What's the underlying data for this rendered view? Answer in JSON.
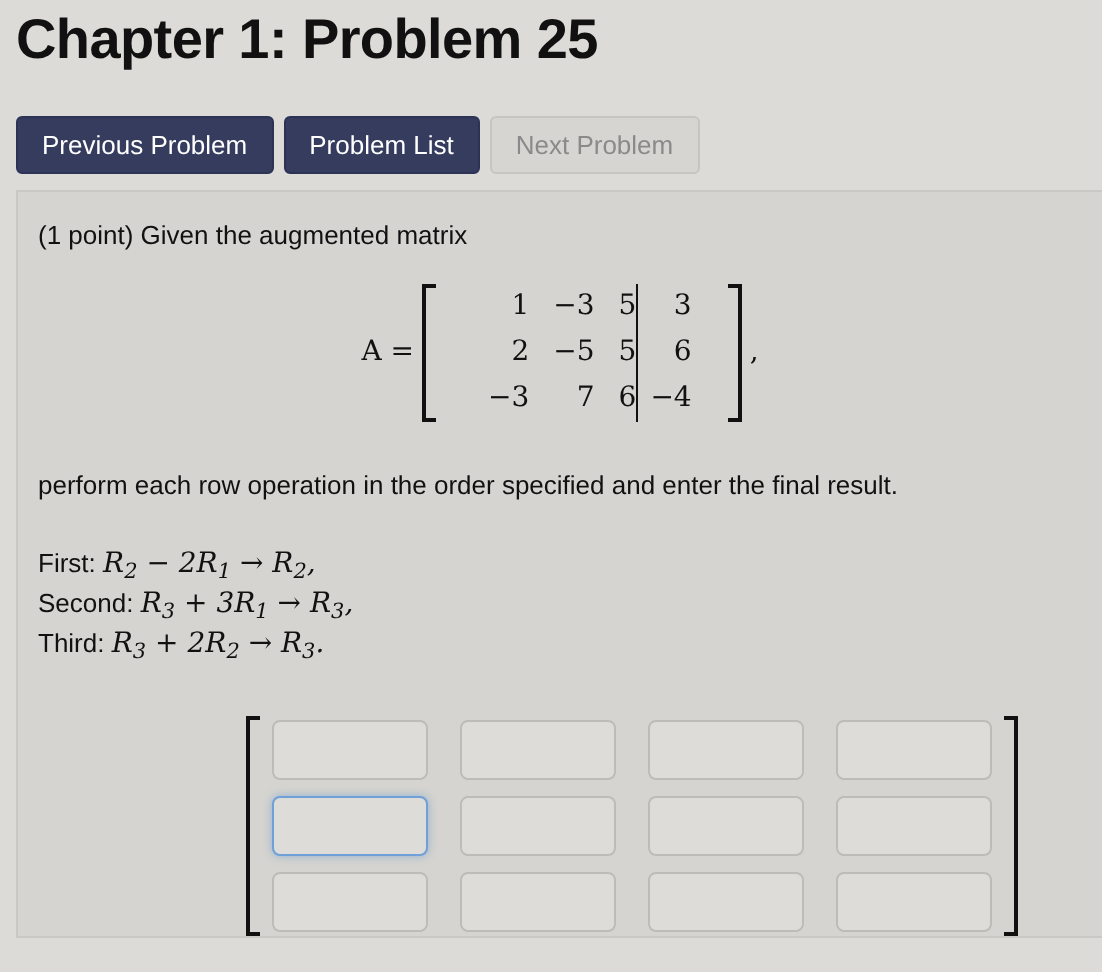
{
  "title": "Chapter 1: Problem 25",
  "nav_buttons": [
    {
      "label": "Previous Problem",
      "disabled": false
    },
    {
      "label": "Problem List",
      "disabled": false
    },
    {
      "label": "Next Problem",
      "disabled": true
    }
  ],
  "problem": {
    "intro": "(1 point) Given the augmented matrix",
    "matrix": {
      "name": "A",
      "equals": "=",
      "rows": [
        {
          "coefficients": [
            "1",
            "−3",
            "5"
          ],
          "constant": "3"
        },
        {
          "coefficients": [
            "2",
            "−5",
            "5"
          ],
          "constant": "6"
        },
        {
          "coefficients": [
            "−3",
            "7",
            "6"
          ],
          "constant": "−4"
        }
      ],
      "trailing": ","
    },
    "instruction": "perform each row operation in the order specified and enter the final result.",
    "steps": [
      {
        "label": "First:",
        "operation": "R$_{2}$ − 2R$_{1}$ → R$_{2}$,"
      },
      {
        "label": "Second:",
        "operation": "R$_{3}$ + 3R$_{1}$ → R$_{3}$,"
      },
      {
        "label": "Third:",
        "operation": "R$_{3}$ + 2R$_{2}$ → R$_{3}$."
      }
    ],
    "answer_rows": [
      [
        {
          "focused": false
        },
        {
          "focused": false
        },
        {
          "focused": false
        },
        {
          "focused": false
        }
      ],
      [
        {
          "focused": true
        },
        {
          "focused": false
        },
        {
          "focused": false
        },
        {
          "focused": false
        }
      ],
      [
        {
          "focused": false
        },
        {
          "focused": false
        },
        {
          "focused": false
        },
        {
          "focused": false
        }
      ]
    ]
  }
}
